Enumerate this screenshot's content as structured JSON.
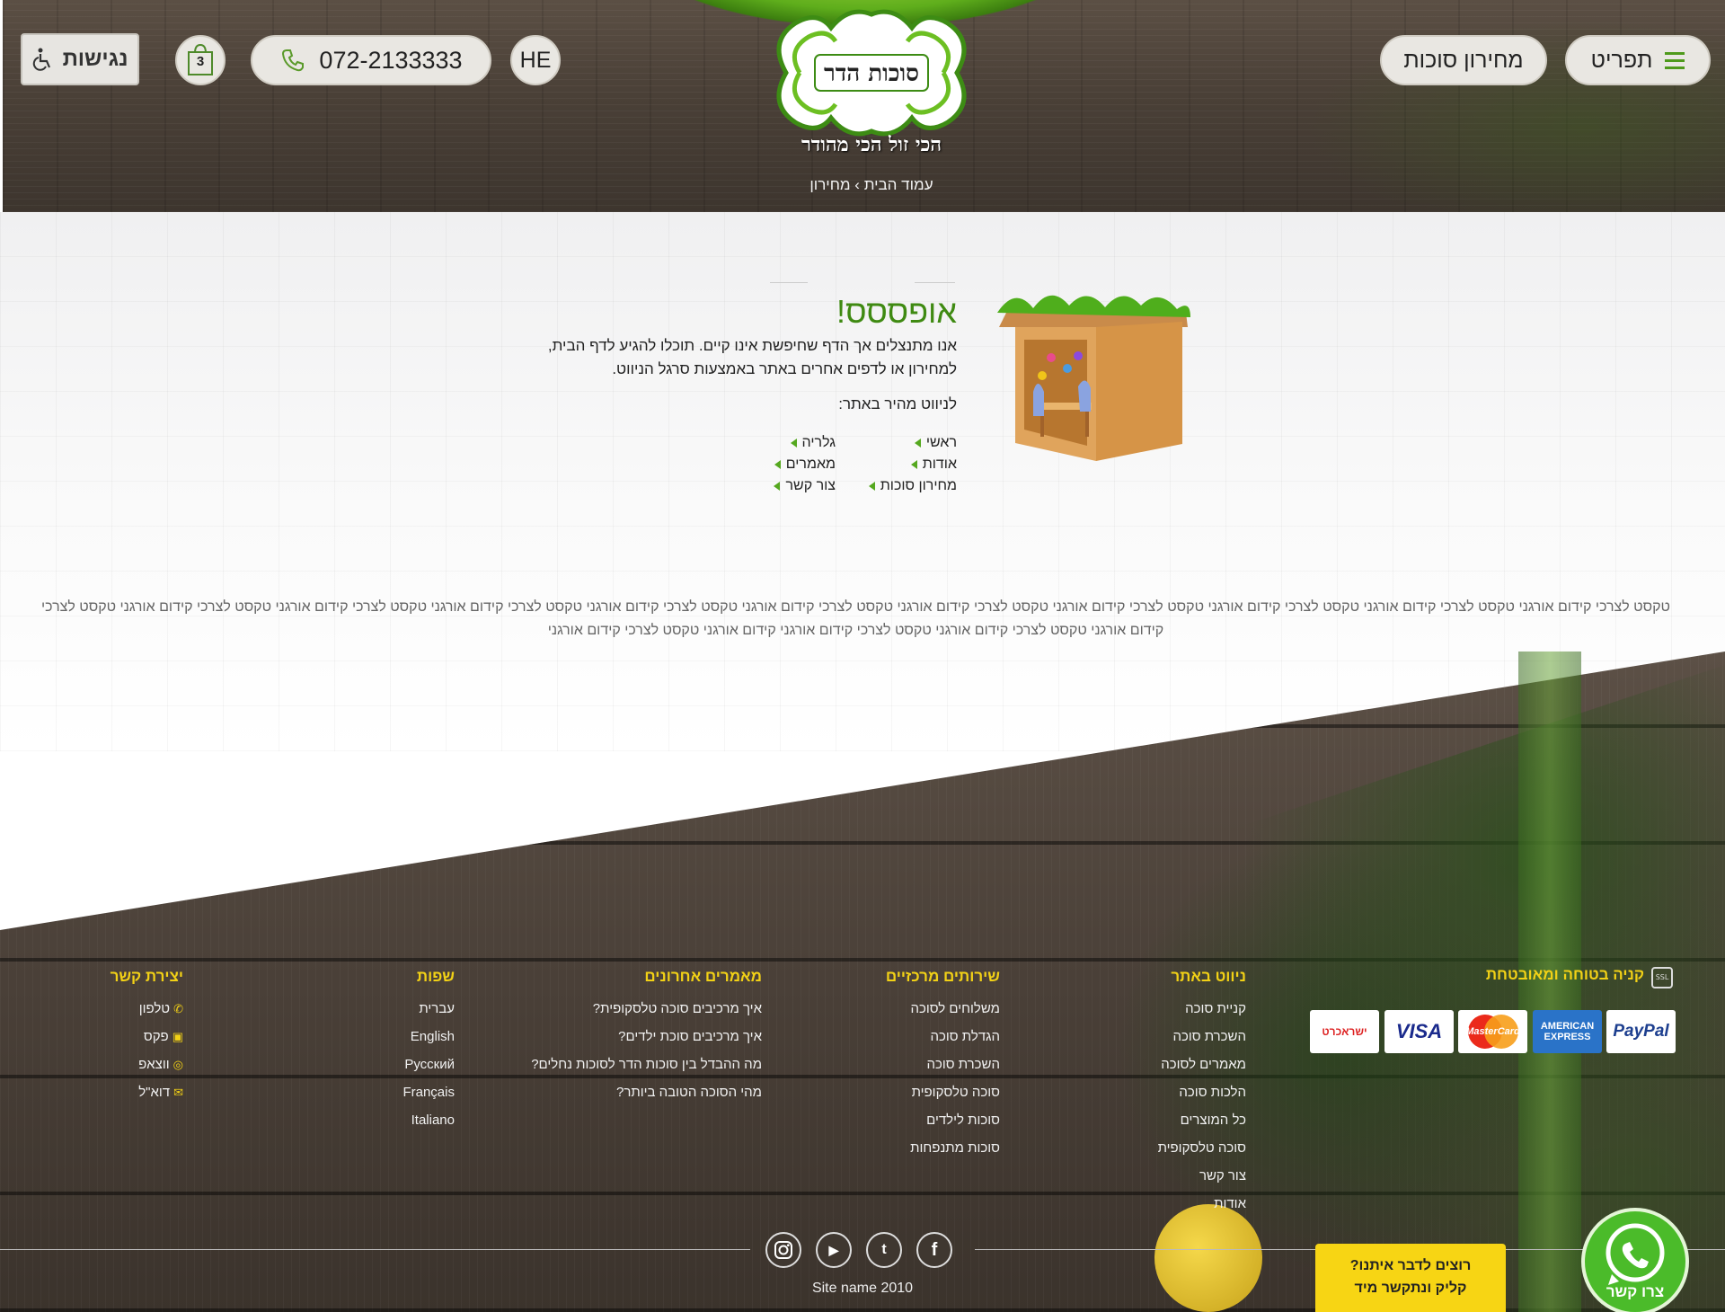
{
  "header": {
    "menu_label": "תפריט",
    "price_label": "מחירון סוכות",
    "phone": "072-2133333",
    "lang": "HE",
    "cart_count": "3",
    "accessibility_label": "נגישות",
    "logo_text": "סוכות הדר",
    "slogan": "הכי זול הכי מהודר",
    "breadcrumb": "עמוד הבית › מחירון"
  },
  "error": {
    "title": "אופססס!",
    "text": "אנו מתנצלים אך הדף שחיפשת אינו קיים. תוכלו להגיע לדף הבית, למחירון או לדפים אחרים באתר באמצעות סרגל הניווט.",
    "quick_nav_title": "לניווט מהיר באתר:",
    "links_right": [
      "ראשי",
      "אודות",
      "מחירון סוכות"
    ],
    "links_left": [
      "גלריה",
      "מאמרים",
      "צור קשר"
    ]
  },
  "seo_text": "טקסט לצרכי קידום אורגני טקסט לצרכי קידום אורגני טקסט לצרכי קידום אורגני טקסט לצרכי קידום אורגני טקסט לצרכי קידום אורגני טקסט לצרכי קידום אורגני טקסט לצרכי קידום אורגני טקסט לצרכי קידום אורגני טקסט לצרכי קידום אורגני טקסט לצרכי קידום אורגני טקסט לצרכי קידום אורגני טקסט לצרכי קידום אורגני טקסט לצרכי קידום אורגני  קידום אורגני טקסט לצרכי קידום אורגני",
  "footer": {
    "secure_title": "קניה בטוחה ומאובטחת",
    "payments": [
      "PayPal",
      "AMERICAN EXPRESS",
      "MasterCard",
      "VISA",
      "ישראכרט"
    ],
    "nav": {
      "title": "ניווט באתר",
      "items": [
        "קניית סוכה",
        "השכרת סוכה",
        "מאמרים לסוכה",
        "הלכות סוכה",
        "כל המוצרים",
        "סוכה טלסקופית",
        "צור קשר",
        "אודות"
      ]
    },
    "services": {
      "title": "שירותים מרכזיים",
      "items": [
        "משלוחים לסוכה",
        "הגדלת סוכה",
        "השכרת סוכה",
        "סוכה טלסקופית",
        "סוכות לילדים",
        "סוכות מתנפחות"
      ]
    },
    "articles": {
      "title": "מאמרים אחרונים",
      "items": [
        "איך מרכיבים סוכה טלסקופית?",
        "איך מרכיבים סוכת ילדים?",
        "מה ההבדל בין סוכות הדר לסוכות נחלים?",
        "מהי הסוכה הטובה ביותר?"
      ]
    },
    "languages": {
      "title": "שפות",
      "items": [
        "עברית",
        "English",
        "Русский",
        "Français",
        "Italiano"
      ]
    },
    "contact": {
      "title": "יצירת קשר",
      "items": [
        "טלפון",
        "פקס",
        "ווצאפ",
        "דוא\"ל"
      ]
    },
    "site_name": "Site name 2010",
    "call_box_line1": "רוצים לדבר איתנו?",
    "call_box_line2": "קליק ונתקשר מיד",
    "whatsapp_label": "צרו קשר"
  }
}
